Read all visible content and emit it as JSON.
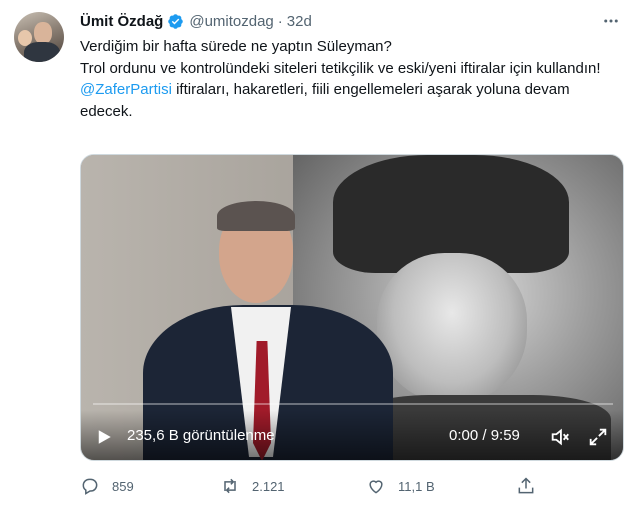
{
  "author": {
    "name": "Ümit Özdağ",
    "handle": "@umitozdag",
    "separator": "·",
    "time": "32d",
    "verified_color": "#1d9bf0"
  },
  "tweet": {
    "line1": "Verdiğim bir hafta sürede ne yaptın Süleyman?",
    "line2": "Trol ordunu ve kontrolündeki siteleri tetikçilik ve eski/yeni iftiralar için kullandın!",
    "mention": "@ZaferPartisi",
    "line3": " iftiraları, hakaretleri, fiili engellemeleri aşarak yoluna devam edecek."
  },
  "video": {
    "views": "235,6 B görüntülenme",
    "duration": "0:00 / 9:59",
    "progress": 0
  },
  "icons": {
    "more": "more-icon",
    "verified": "verified-badge-icon",
    "play": "play-icon",
    "volume": "volume-icon",
    "fullscreen": "fullscreen-icon",
    "reply": "reply-icon",
    "retweet": "retweet-icon",
    "like": "like-icon",
    "share": "share-icon"
  },
  "actions": {
    "replies": "859",
    "retweets": "2.121",
    "likes": "11,1 B"
  },
  "colors": {
    "text": "#0f1419",
    "muted": "#536471",
    "accent": "#1d9bf0"
  }
}
